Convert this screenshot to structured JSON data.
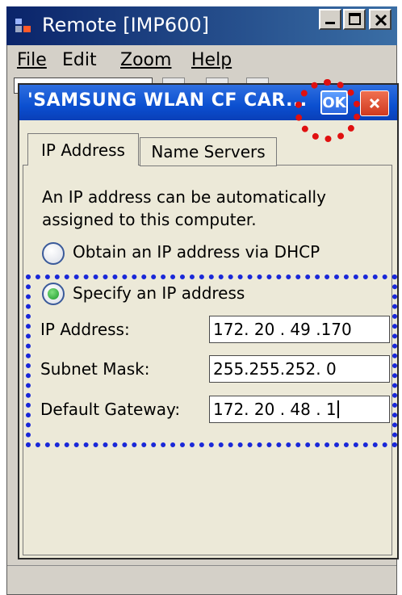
{
  "window": {
    "title": "Remote [IMP600]",
    "menu": [
      {
        "label": "File",
        "hotkey_index": 0
      },
      {
        "label": "Edit",
        "hotkey_index": 0
      },
      {
        "label": "Zoom",
        "hotkey_index": 0
      },
      {
        "label": "Help",
        "hotkey_index": 0
      }
    ]
  },
  "dialog": {
    "title": "'SAMSUNG WLAN CF CAR...",
    "ok_label": "OK",
    "tabs": [
      {
        "label": "IP Address",
        "selected": true
      },
      {
        "label": "Name Servers",
        "selected": false
      }
    ],
    "description": "An IP address can be automatically assigned to this computer.",
    "options": {
      "dhcp": {
        "label": "Obtain an IP address via DHCP",
        "checked": false
      },
      "specify": {
        "label": "Specify an IP address",
        "checked": true
      }
    },
    "fields": {
      "ip_address": {
        "label": "IP Address:",
        "value": "172. 20 . 49 .170"
      },
      "subnet_mask": {
        "label": "Subnet Mask:",
        "value": "255.255.252. 0"
      },
      "gateway": {
        "label": "Default Gateway:",
        "value": "172. 20 . 48 . 1"
      }
    }
  },
  "colors": {
    "ok_highlight": "#e01010",
    "specify_highlight": "#1a28d8",
    "dialog_title_blue": "#0b4fd0"
  },
  "icons": [
    "app-icon",
    "minimize-icon",
    "maximize-icon",
    "close-icon",
    "close-dialog-icon"
  ]
}
